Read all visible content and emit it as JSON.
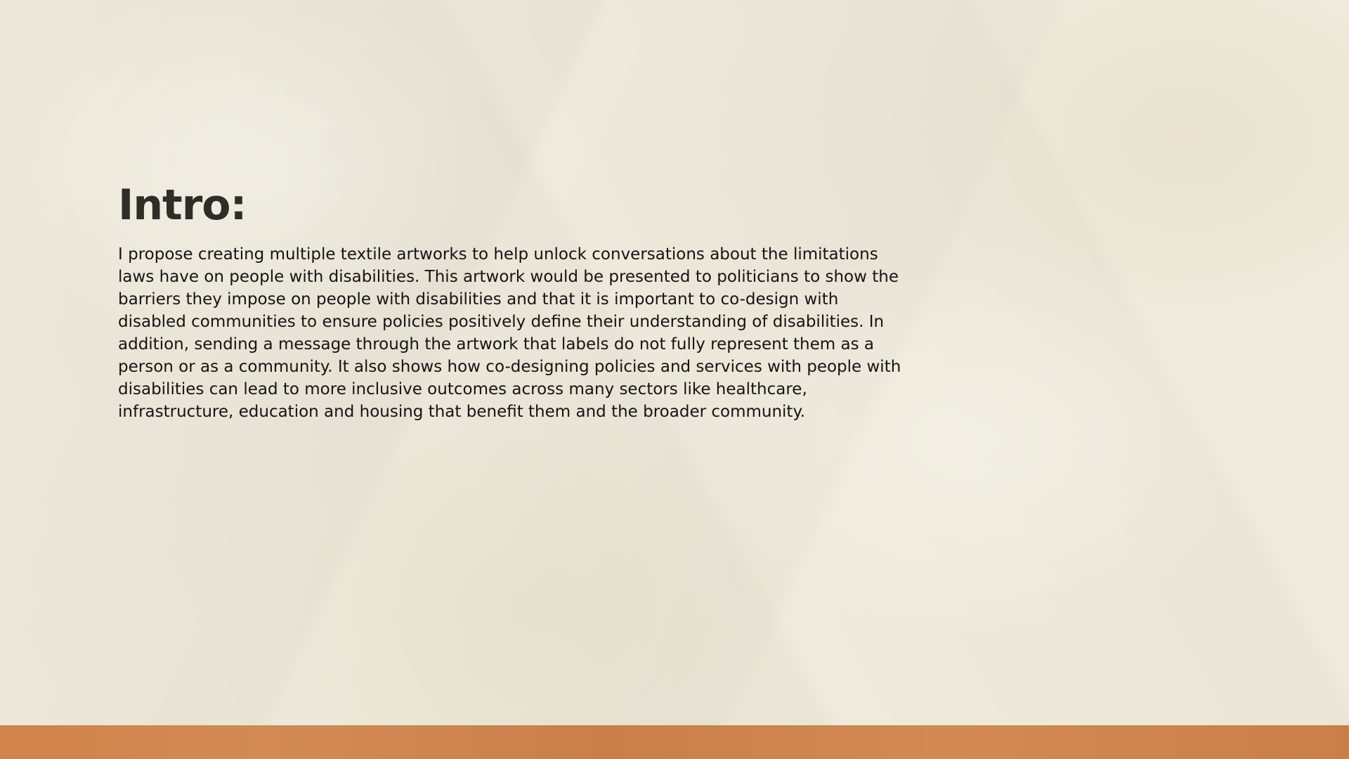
{
  "slide": {
    "title": "Intro:",
    "paragraph": "I propose creating multiple textile artworks to help unlock conversations about the limitations laws have on people with disabilities. This artwork would be presented to politicians to show the barriers they impose on people with disabilities and that it is important to co-design with disabled communities to ensure policies positively define their understanding of disabilities. In addition, sending a message through the artwork that labels do not fully represent them as a person or as a community. It also shows how co-designing policies and services with people with disabilities can lead to more inclusive outcomes across many sectors like healthcare, infrastructure, education and housing that benefit them and the broader community."
  },
  "colors": {
    "background": "#efeadb",
    "title": "#2f2d28",
    "text": "#141414",
    "footer_bar": "#d0834a"
  }
}
